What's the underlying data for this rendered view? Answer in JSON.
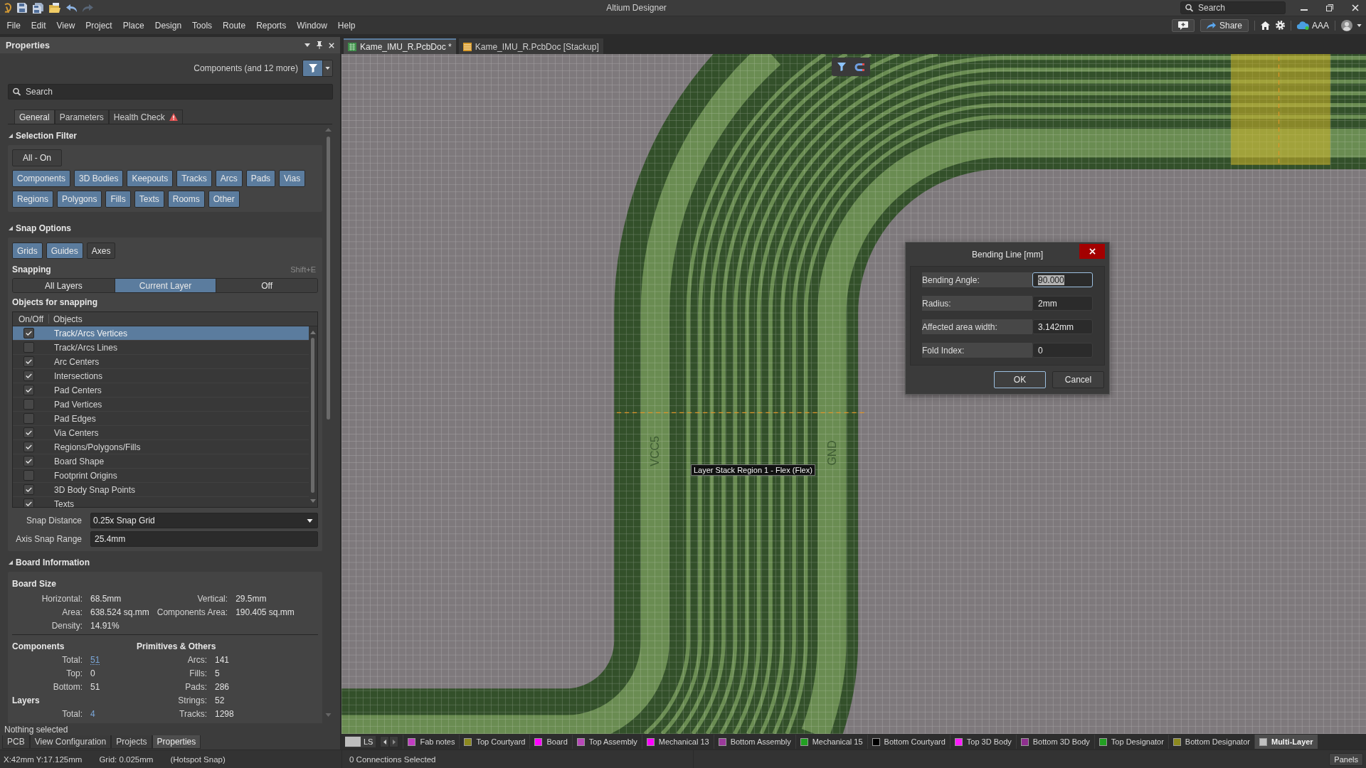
{
  "title_bar": {
    "title": "Altium Designer",
    "quick_access": [
      {
        "kind": "save",
        "disabled": false
      },
      {
        "kind": "save_all",
        "disabled": false
      },
      {
        "kind": "open",
        "disabled": false
      },
      {
        "kind": "undo",
        "disabled": false
      },
      {
        "kind": "redo",
        "disabled": true
      }
    ],
    "search": {
      "placeholder": "Search"
    }
  },
  "menu": [
    "File",
    "Edit",
    "View",
    "Project",
    "Place",
    "Design",
    "Tools",
    "Route",
    "Reports",
    "Window",
    "Help"
  ],
  "menu_bar_right": {
    "share_button": "Share",
    "account": "AAA"
  },
  "properties_panel": {
    "title": "Properties",
    "object_filter": "Components (and 12 more)",
    "search": {
      "placeholder": "Search"
    },
    "tabs": [
      {
        "label": "General",
        "selected": true,
        "warning": false
      },
      {
        "label": "Parameters",
        "selected": false,
        "warning": false
      },
      {
        "label": "Health Check",
        "selected": false,
        "warning": true
      }
    ],
    "selection_filter": {
      "title": "Selection Filter",
      "expanded": true,
      "all_button": {
        "label": "All - On",
        "on": false
      },
      "rows": [
        {
          "buttons": [
            {
              "label": "Components",
              "on": true
            },
            {
              "label": "3D Bodies",
              "on": true
            },
            {
              "label": "Keepouts",
              "on": true
            },
            {
              "label": "Tracks",
              "on": true
            },
            {
              "label": "Arcs",
              "on": true
            },
            {
              "label": "Pads",
              "on": true
            },
            {
              "label": "Vias",
              "on": true
            }
          ]
        },
        {
          "buttons": [
            {
              "label": "Regions",
              "on": true
            },
            {
              "label": "Polygons",
              "on": true
            },
            {
              "label": "Fills",
              "on": true
            },
            {
              "label": "Texts",
              "on": true
            },
            {
              "label": "Rooms",
              "on": true
            },
            {
              "label": "Other",
              "on": true
            }
          ]
        }
      ]
    },
    "snap_options": {
      "title": "Snap Options",
      "expanded": true,
      "guides": [
        {
          "label": "Grids",
          "on": true
        },
        {
          "label": "Guides",
          "on": true
        },
        {
          "label": "Axes",
          "on": false
        }
      ],
      "snapping": {
        "label": "Snapping",
        "shortcut": "Shift+E",
        "modes": [
          {
            "label": "All Layers",
            "selected": false
          },
          {
            "label": "Current Layer",
            "selected": true
          },
          {
            "label": "Off",
            "selected": false
          }
        ]
      },
      "objects": {
        "title": "Objects for snapping",
        "columns": [
          "On/Off",
          "Objects"
        ],
        "rows": [
          {
            "label": "Track/Arcs Vertices",
            "checked": true,
            "selected": true
          },
          {
            "label": "Track/Arcs Lines",
            "checked": false,
            "selected": false
          },
          {
            "label": "Arc Centers",
            "checked": true,
            "selected": false
          },
          {
            "label": "Intersections",
            "checked": true,
            "selected": false
          },
          {
            "label": "Pad Centers",
            "checked": true,
            "selected": false
          },
          {
            "label": "Pad Vertices",
            "checked": false,
            "selected": false
          },
          {
            "label": "Pad Edges",
            "checked": false,
            "selected": false
          },
          {
            "label": "Via Centers",
            "checked": true,
            "selected": false
          },
          {
            "label": "Regions/Polygons/Fills",
            "checked": true,
            "selected": false
          },
          {
            "label": "Board Shape",
            "checked": true,
            "selected": false
          },
          {
            "label": "Footprint Origins",
            "checked": false,
            "selected": false
          },
          {
            "label": "3D Body Snap Points",
            "checked": true,
            "selected": false
          },
          {
            "label": "Texts",
            "checked": true,
            "selected": false
          }
        ]
      },
      "snap_distance": {
        "label": "Snap Distance",
        "value": "0.25x Snap Grid"
      },
      "axis_snap_range": {
        "label": "Axis Snap Range",
        "value": "25.4mm"
      }
    },
    "board_information": {
      "title": "Board Information",
      "expanded": true,
      "board_size": {
        "title": "Board Size",
        "rows": [
          {
            "label": "Horizontal:",
            "value": "68.5mm",
            "label_2": "Vertical:",
            "value_2": "29.5mm"
          },
          {
            "label": "Area:",
            "value": "638.524 sq.mm",
            "label_2": "Components Area:",
            "value_2": "190.405 sq.mm"
          },
          {
            "label": "Density:",
            "value": "14.91%"
          }
        ]
      },
      "counts": [
        {
          "left": {
            "kind": "heading",
            "text": "Components"
          },
          "right": {
            "kind": "heading",
            "text": "Primitives & Others"
          }
        },
        {
          "left": {
            "kind": "pair",
            "label": "Total:",
            "value": "51",
            "link": true,
            "hovered": true
          },
          "right": {
            "kind": "pair",
            "label": "Arcs:",
            "value": "141",
            "link": false,
            "hovered": false
          }
        },
        {
          "left": {
            "kind": "pair",
            "label": "Top:",
            "value": "0",
            "link": false,
            "hovered": false
          },
          "right": {
            "kind": "pair",
            "label": "Fills:",
            "value": "5",
            "link": false,
            "hovered": false
          }
        },
        {
          "left": {
            "kind": "pair",
            "label": "Bottom:",
            "value": "51",
            "link": false,
            "hovered": false
          },
          "right": {
            "kind": "pair",
            "label": "Pads:",
            "value": "286",
            "link": false,
            "hovered": false
          }
        },
        {
          "left": {
            "kind": "heading",
            "text": "Layers"
          },
          "right": {
            "kind": "pair",
            "label": "Strings:",
            "value": "52",
            "link": false,
            "hovered": false
          }
        },
        {
          "left": {
            "kind": "pair",
            "label": "Total:",
            "value": "4",
            "link": true,
            "hovered": false
          },
          "right": {
            "kind": "pair",
            "label": "Tracks:",
            "value": "1298",
            "link": false,
            "hovered": false
          }
        }
      ]
    },
    "status": "Nothing selected",
    "panel_tabs": [
      {
        "label": "PCB",
        "selected": false
      },
      {
        "label": "View Configuration",
        "selected": false
      },
      {
        "label": "Projects",
        "selected": false
      },
      {
        "label": "Properties",
        "selected": true
      }
    ]
  },
  "document_tabs": [
    {
      "label": "Kame_IMU_R.PcbDoc *",
      "selected": true,
      "kind": "pcb"
    },
    {
      "label": "Kame_IMU_R.PcbDoc [Stackup]",
      "selected": false,
      "kind": "stackup"
    }
  ],
  "canvas": {
    "net_labels": [
      "VCC5",
      "GND"
    ],
    "region_label": "Layer Stack Region 1 - Flex (Flex)"
  },
  "dialog": {
    "title": "Bending Line [mm]",
    "fields": [
      {
        "label": "Bending Angle:",
        "value": "90.000",
        "focused": true
      },
      {
        "label": "Radius:",
        "value": "2mm",
        "focused": false
      },
      {
        "label": "Affected area width:",
        "value": "3.142mm",
        "focused": false
      },
      {
        "label": "Fold Index:",
        "value": "0",
        "focused": false
      }
    ],
    "buttons": [
      {
        "label": "OK",
        "default": true
      },
      {
        "label": "Cancel",
        "default": false
      }
    ]
  },
  "layer_bar": {
    "layer_set": "LS",
    "layers": [
      {
        "name": "Fab notes",
        "color": "#c23dc2",
        "selected": false
      },
      {
        "name": "Top Courtyard",
        "color": "#8c891f",
        "selected": false
      },
      {
        "name": "Board",
        "color": "#ff00ff",
        "selected": false
      },
      {
        "name": "Top Assembly",
        "color": "#b848b8",
        "selected": false
      },
      {
        "name": "Mechanical 13",
        "color": "#ff00ff",
        "selected": false
      },
      {
        "name": "Bottom Assembly",
        "color": "#9b3a9b",
        "selected": false
      },
      {
        "name": "Mechanical 15",
        "color": "#22a022",
        "selected": false
      },
      {
        "name": "Bottom Courtyard",
        "color": "#000000",
        "selected": false
      },
      {
        "name": "Top 3D Body",
        "color": "#ff1aff",
        "selected": false
      },
      {
        "name": "Bottom 3D Body",
        "color": "#8f2f8f",
        "selected": false
      },
      {
        "name": "Top Designator",
        "color": "#22a022",
        "selected": false
      },
      {
        "name": "Bottom Designator",
        "color": "#8c891f",
        "selected": false
      },
      {
        "name": "Multi-Layer",
        "color": "#c0c0c0",
        "selected": true
      }
    ]
  },
  "status_bar": {
    "coordinates": "X:42mm Y:17.125mm",
    "grid": "Grid: 0.025mm",
    "snap_mode": "(Hotspot Snap)",
    "connections": "0 Connections Selected",
    "panels_button": "Panels"
  }
}
